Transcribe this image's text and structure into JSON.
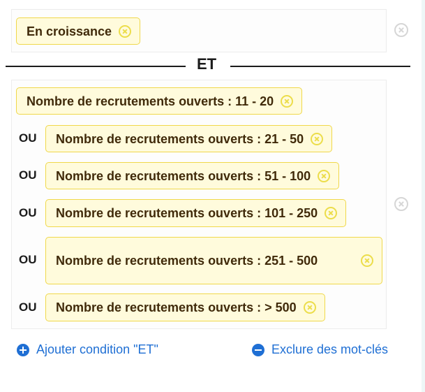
{
  "group1": {
    "chip": "En croissance"
  },
  "separator": {
    "label": "ET"
  },
  "group2": {
    "first_chip": "Nombre de recrutements ouverts : 11 - 20",
    "or_label": "OU",
    "rows": [
      {
        "chip": "Nombre de recrutements ouverts : 21 - 50"
      },
      {
        "chip": "Nombre de recrutements ouverts : 51 - 100"
      },
      {
        "chip": "Nombre de recrutements ouverts : 101 - 250"
      },
      {
        "chip": "Nombre de recrutements ouverts : 251 - 500"
      },
      {
        "chip": "Nombre de recrutements ouverts : > 500"
      }
    ]
  },
  "actions": {
    "add_label": "Ajouter condition \"ET\"",
    "exclude_label": "Exclure des mot-clés"
  },
  "colors": {
    "chip_bg": "#fffbdc",
    "chip_border": "#f0d84a",
    "chip_text": "#402a0a",
    "accent": "#1f6fd4"
  }
}
